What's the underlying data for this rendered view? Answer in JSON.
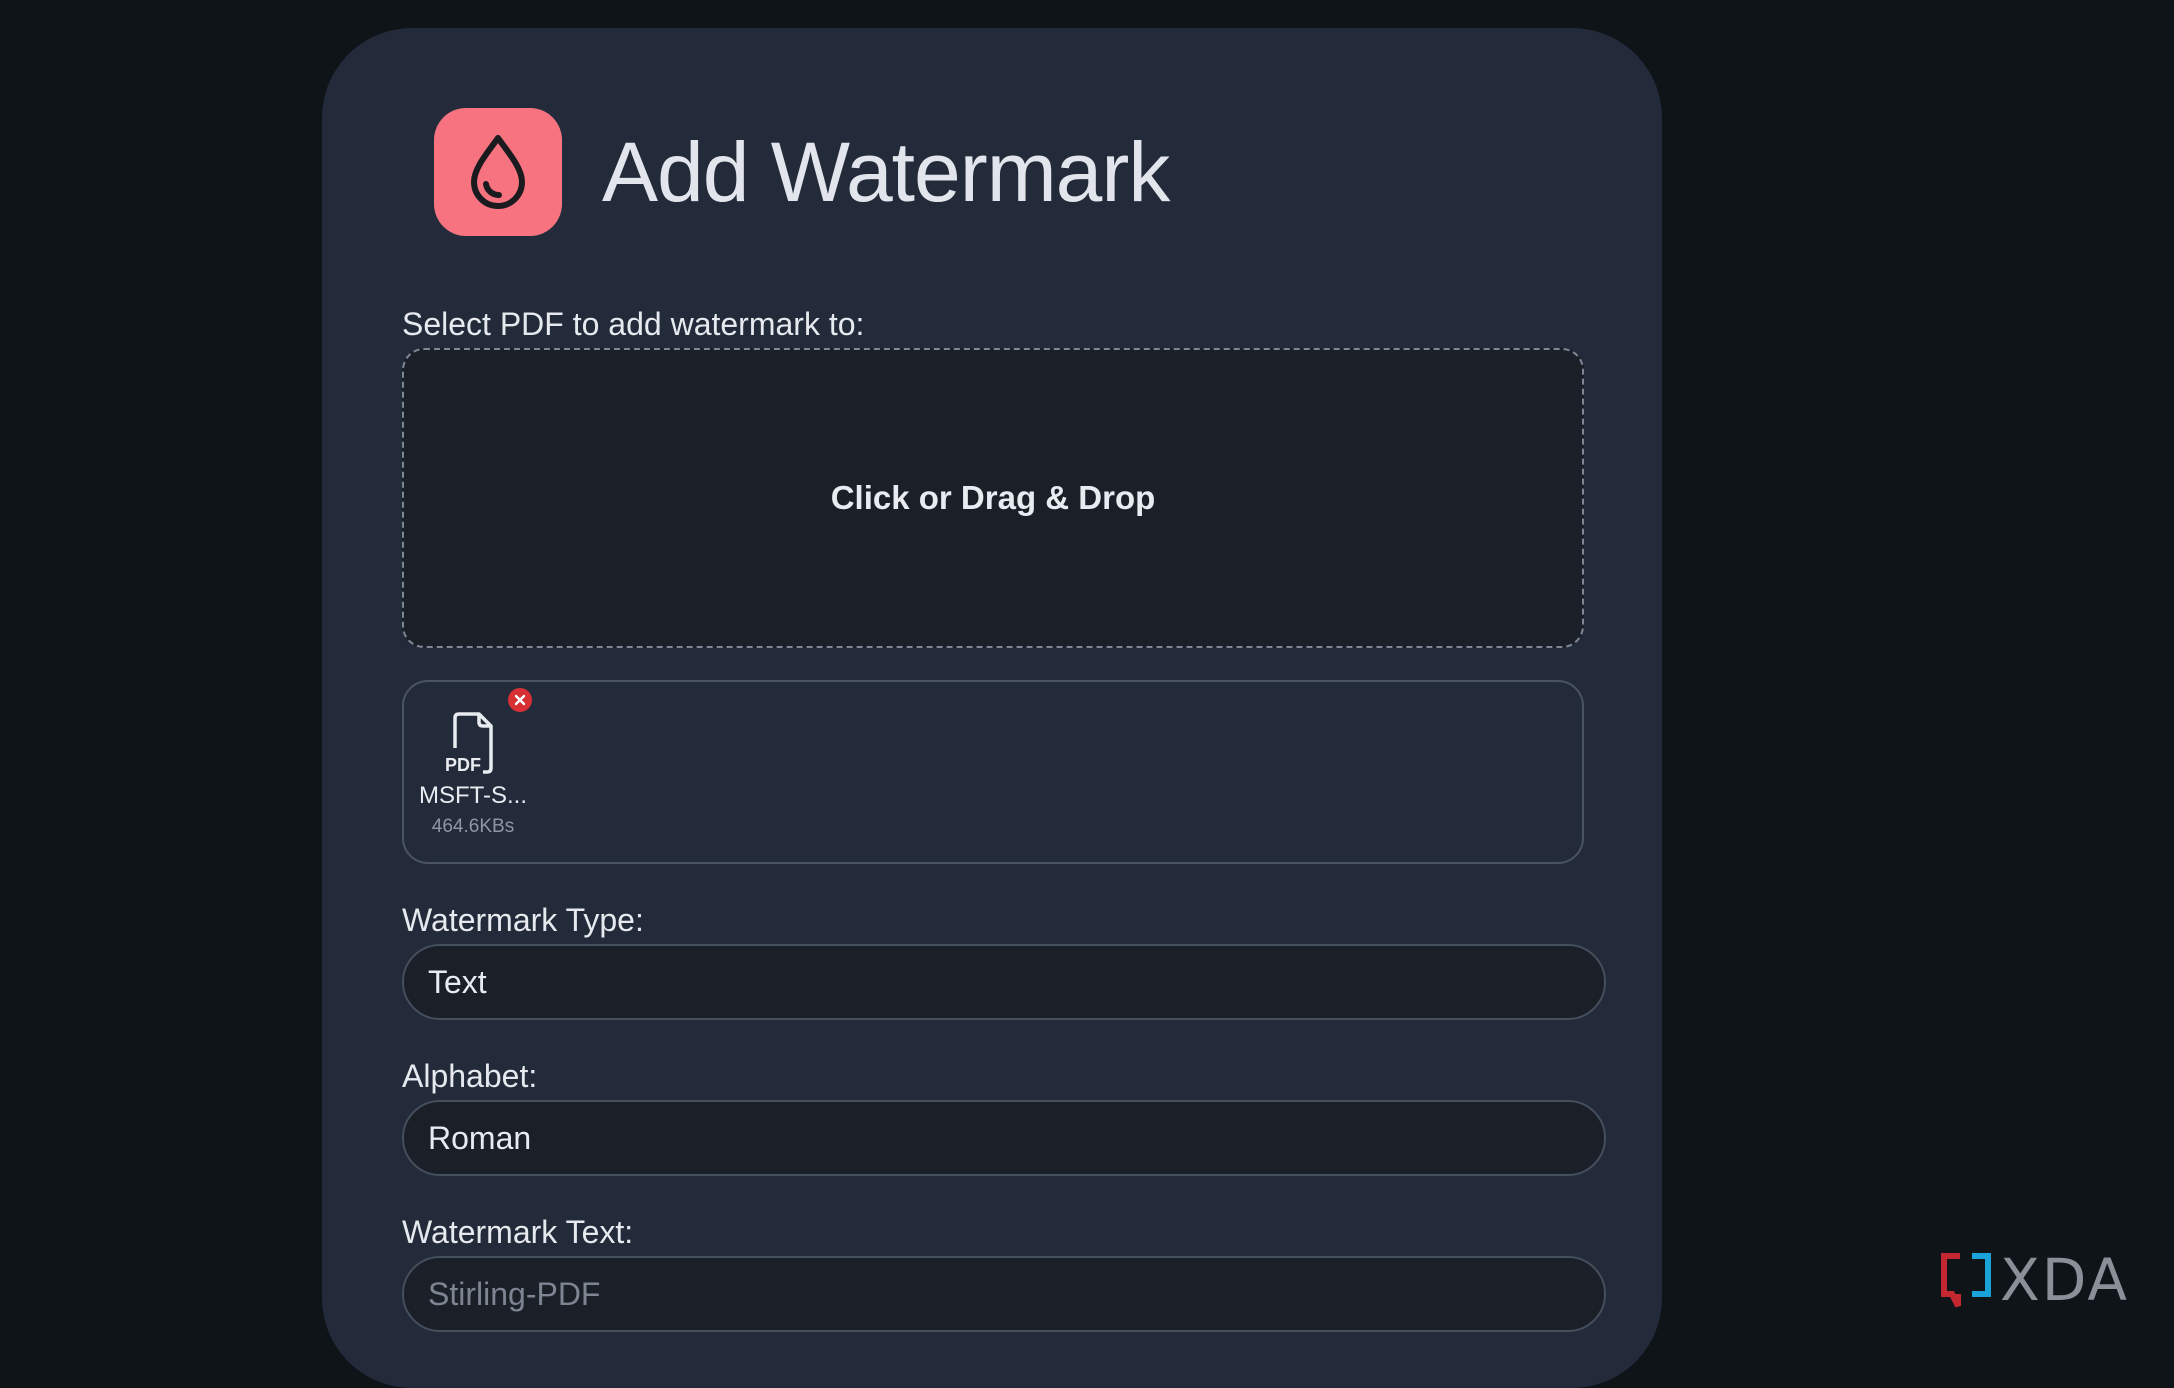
{
  "header": {
    "title": "Add Watermark",
    "icon": "water-drop-icon",
    "icon_bg": "#f7737f"
  },
  "upload": {
    "label": "Select PDF to add watermark to:",
    "dropzone_text": "Click or Drag & Drop"
  },
  "files": [
    {
      "type_label": "PDF",
      "name": "MSFT-S...",
      "size": "464.6KBs"
    }
  ],
  "watermark_type": {
    "label": "Watermark Type:",
    "value": "Text"
  },
  "alphabet": {
    "label": "Alphabet:",
    "value": "Roman"
  },
  "watermark_text": {
    "label": "Watermark Text:",
    "placeholder": "Stirling-PDF"
  },
  "site_logo": {
    "text": "XDA"
  }
}
